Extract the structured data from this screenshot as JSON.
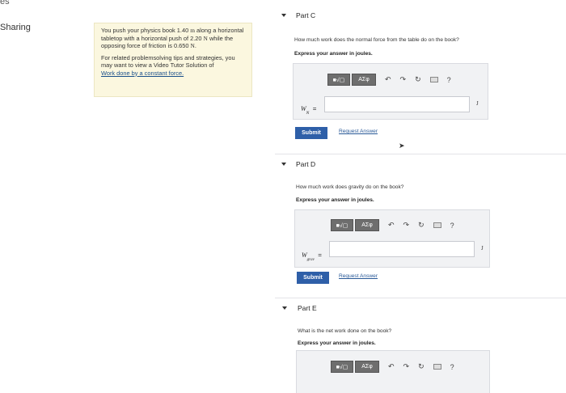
{
  "page": {
    "top_fragment": "es",
    "sidebar_label": "Sharing"
  },
  "problem": {
    "paragraph1_a": "You push your physics book 1.40 ",
    "unit_m": "m",
    "paragraph1_b": " along a horizontal tabletop with a horizontal push of 2.20 ",
    "unit_n1": "N",
    "paragraph1_c": " while the opposing force of friction is 0.650 ",
    "unit_n2": "N",
    "paragraph1_d": ".",
    "paragraph2": "For related problemsolving tips and strategies, you may want to view a Video Tutor Solution of",
    "link": "Work done by a constant force."
  },
  "toolbar": {
    "templates_label": "■√▢",
    "greek_label": "ΑΣφ",
    "undo_icon": "↶",
    "redo_icon": "↷",
    "reset_icon": "↻",
    "help_label": "?"
  },
  "parts": {
    "c": {
      "title": "Part C",
      "question": "How much work does the normal force from the table do on the book?",
      "instruction": "Express your answer in joules.",
      "var_label": "W",
      "var_sub": "N",
      "equals": "=",
      "input_value": "",
      "unit": "J",
      "submit": "Submit",
      "request": "Request Answer"
    },
    "d": {
      "title": "Part D",
      "question": "How much work does gravity do on the book?",
      "instruction": "Express your answer in joules.",
      "var_label": "W",
      "var_sub": "grav",
      "equals": "=",
      "input_value": "",
      "unit": "J",
      "submit": "Submit",
      "request": "Request Answer"
    },
    "e": {
      "title": "Part E",
      "question": "What is the net work done on the book?",
      "instruction": "Express your answer in joules."
    }
  },
  "colors": {
    "submit": "#2e5fa8",
    "link": "#2a5a98",
    "problem_bg": "#fbf7df"
  }
}
